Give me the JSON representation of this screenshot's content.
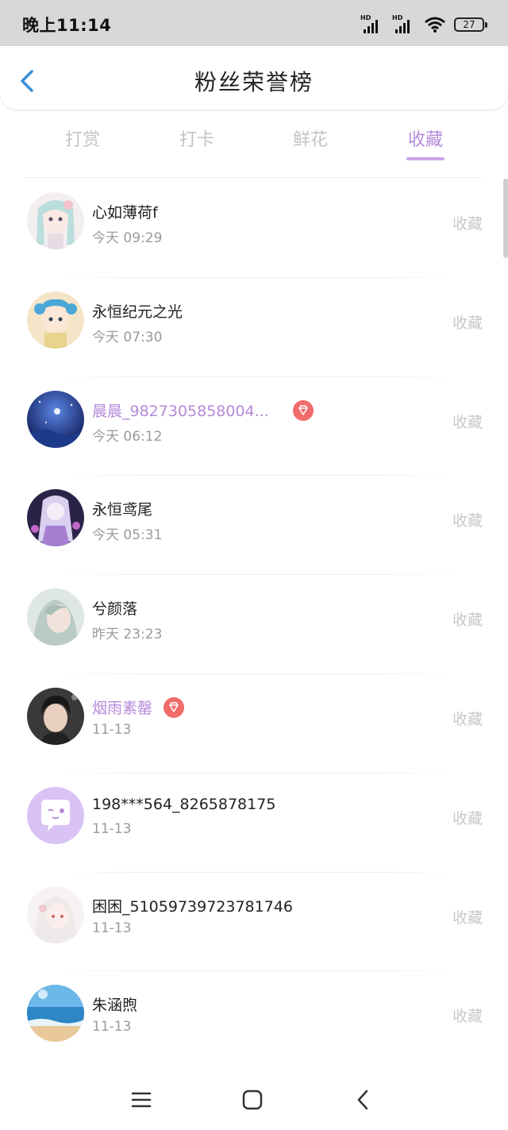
{
  "status_bar": {
    "time": "晚上11:14",
    "signal_label": "HD",
    "battery": "27"
  },
  "header": {
    "title": "粉丝荣誉榜"
  },
  "tabs": [
    {
      "label": "打赏",
      "active": false
    },
    {
      "label": "打卡",
      "active": false
    },
    {
      "label": "鲜花",
      "active": false
    },
    {
      "label": "收藏",
      "active": true
    }
  ],
  "rows": [
    {
      "name": "心如薄荷f",
      "time": "今天 09:29",
      "action": "收藏",
      "vip": false
    },
    {
      "name": "永恒纪元之光",
      "time": "今天 07:30",
      "action": "收藏",
      "vip": false
    },
    {
      "name": "晨晨_9827305858004...",
      "time": "今天 06:12",
      "action": "收藏",
      "vip": true
    },
    {
      "name": "永恒鸢尾",
      "time": "今天 05:31",
      "action": "收藏",
      "vip": false
    },
    {
      "name": "兮颜落",
      "time": "昨天 23:23",
      "action": "收藏",
      "vip": false
    },
    {
      "name": "烟雨素罄",
      "time": "11-13",
      "action": "收藏",
      "vip": true
    },
    {
      "name": "198***564_8265878175",
      "time": "11-13",
      "action": "收藏",
      "vip": false
    },
    {
      "name": "困困_51059739723781746",
      "time": "11-13",
      "action": "收藏",
      "vip": false
    },
    {
      "name": "朱涵煦",
      "time": "11-13",
      "action": "收藏",
      "vip": false
    }
  ],
  "colors": {
    "accent": "#b58ad9",
    "vip_badge": "#f16b6b",
    "back_arrow": "#3b8fd9"
  }
}
